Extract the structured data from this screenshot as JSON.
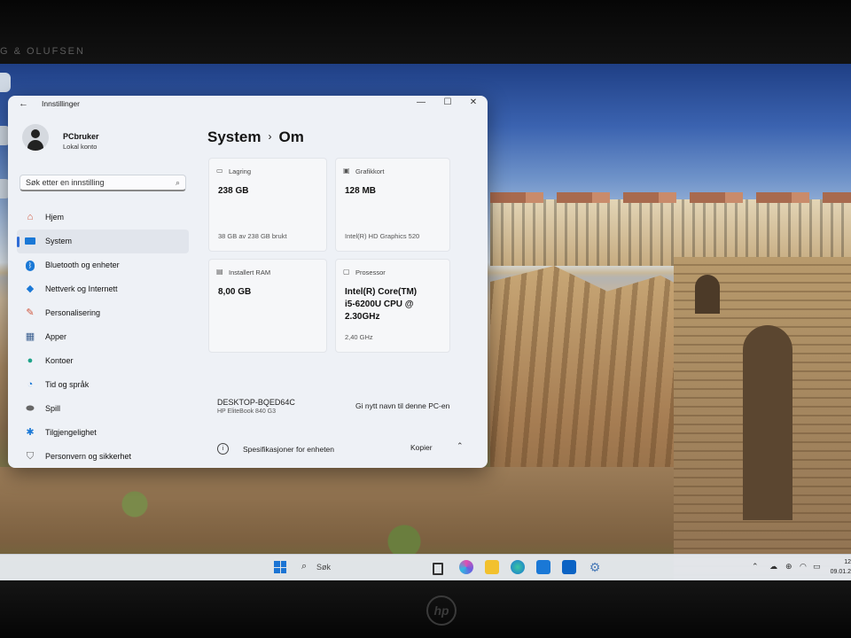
{
  "bezel": {
    "brand_text": "G & OLUFSEN"
  },
  "window": {
    "title": "Innstillinger",
    "icons": {
      "back": "back-arrow-icon",
      "minimize": "minimize-icon",
      "maximize": "maximize-icon",
      "close": "close-icon"
    }
  },
  "user": {
    "name": "PCbruker",
    "account_type": "Lokal konto"
  },
  "search": {
    "placeholder": "Søk etter en innstilling"
  },
  "sidebar": {
    "items": [
      {
        "label": "Hjem",
        "icon": "home-icon",
        "color": "#d0573e"
      },
      {
        "label": "System",
        "icon": "monitor-icon",
        "color": "#1a78d6",
        "selected": true
      },
      {
        "label": "Bluetooth og enheter",
        "icon": "bluetooth-icon",
        "color": "#1a78d6"
      },
      {
        "label": "Nettverk og Internett",
        "icon": "wifi-icon",
        "color": "#1a78d6"
      },
      {
        "label": "Personalisering",
        "icon": "brush-icon",
        "color": "#d0573e"
      },
      {
        "label": "Apper",
        "icon": "apps-icon",
        "color": "#3a5f8f"
      },
      {
        "label": "Kontoer",
        "icon": "person-icon",
        "color": "#1fa38a"
      },
      {
        "label": "Tid og språk",
        "icon": "globe-clock-icon",
        "color": "#1a78d6"
      },
      {
        "label": "Spill",
        "icon": "gamepad-icon",
        "color": "#666666"
      },
      {
        "label": "Tilgjengelighet",
        "icon": "accessibility-icon",
        "color": "#1a78d6"
      },
      {
        "label": "Personvern og sikkerhet",
        "icon": "shield-icon",
        "color": "#666666"
      }
    ]
  },
  "breadcrumb": {
    "parent": "System",
    "separator": "›",
    "current": "Om"
  },
  "cards": {
    "storage": {
      "label": "Lagring",
      "value": "238 GB",
      "sub": "38 GB av 238 GB brukt"
    },
    "graphics": {
      "label": "Grafikkort",
      "value": "128 MB",
      "sub": "Intel(R) HD Graphics 520"
    },
    "ram": {
      "label": "Installert RAM",
      "value": "8,00 GB"
    },
    "cpu": {
      "label": "Prosessor",
      "value_line1": "Intel(R) Core(TM)",
      "value_line2": "i5-6200U CPU @",
      "value_line3": "2.30GHz",
      "sub": "2,40 GHz"
    }
  },
  "device": {
    "name": "DESKTOP-BQED64C",
    "model": "HP EliteBook 840 G3",
    "rename_label": "Gi nytt navn til denne PC-en"
  },
  "specs": {
    "label": "Spesifikasjoner for enheten",
    "copy_label": "Kopier"
  },
  "taskbar": {
    "search_label": "Søk",
    "apps": [
      "task-view-icon",
      "copilot-icon",
      "file-explorer-icon",
      "edge-icon",
      "store-icon",
      "outlook-icon",
      "settings-icon"
    ],
    "clock_time": "12",
    "clock_date": "09.01.2"
  },
  "colors": {
    "accent": "#2f6cd6",
    "window_bg": "#eef1f6",
    "card_bg": "#f6f7f9"
  }
}
